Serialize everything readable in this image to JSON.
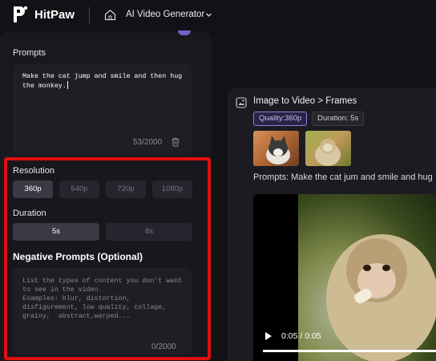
{
  "header": {
    "brand": "HitPaw",
    "app_title": "AI Video Generator"
  },
  "left_panel": {
    "prompts_label": "Prompts",
    "prompt_value": "Make the cat jump and smile and then hug the monkey.",
    "prompt_counter": "53/2000",
    "resolution_label": "Resolution",
    "resolution_options": [
      "360p",
      "540p",
      "720p",
      "1080p"
    ],
    "resolution_selected": "360p",
    "duration_label": "Duration",
    "duration_options": [
      "5s",
      "8s"
    ],
    "duration_selected": "5s",
    "negative_label": "Negative Prompts (Optional)",
    "negative_placeholder": "List the types of content you don't want to see in the video.\nExamples: blur, distortion, disfigurement, low quality, collage, grainy,  abstract,warped...",
    "negative_counter": "0/2000"
  },
  "result_card": {
    "title": "Image to Video > Frames",
    "quality_tag": "Quality:360p",
    "duration_tag": "Duration: 5s",
    "prompt_line": "Prompts:  Make the cat jum and smile and hug",
    "video": {
      "time": "0:05 / 0:05",
      "progress": 1.0
    }
  },
  "colors": {
    "highlight": "#e10f0f",
    "quality_accent": "#8d7be0"
  }
}
